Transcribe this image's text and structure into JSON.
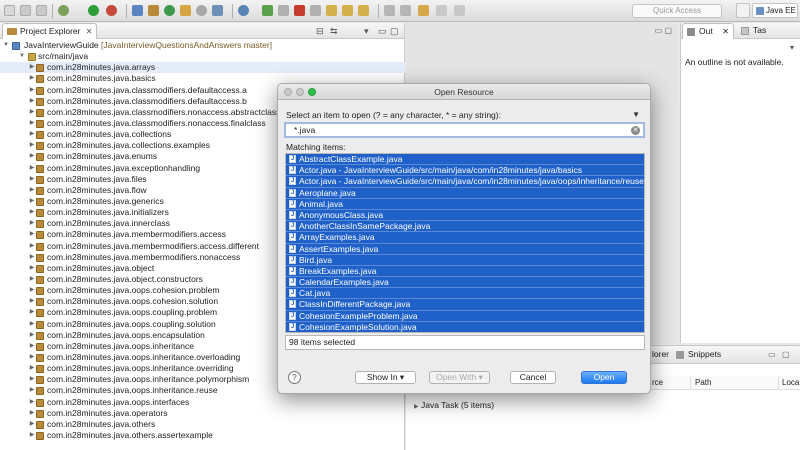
{
  "toolbar": {
    "quick_access_placeholder": "Quick Access",
    "perspective_label": "Java EE"
  },
  "project_explorer": {
    "tab_label": "Project Explorer",
    "tab_close": "✕",
    "project_name": "JavaInterviewGuide",
    "project_suffix": "[JavaInterviewQuestionsAndAnswers master]",
    "source_folder": "src/main/java",
    "packages": [
      "com.in28minutes.java.arrays",
      "com.in28minutes.java.basics",
      "com.in28minutes.java.classmodifiers.defaultaccess.a",
      "com.in28minutes.java.classmodifiers.defaultaccess.b",
      "com.in28minutes.java.classmodifiers.nonaccess.abstractclass",
      "com.in28minutes.java.classmodifiers.nonaccess.finalclass",
      "com.in28minutes.java.collections",
      "com.in28minutes.java.collections.examples",
      "com.in28minutes.java.enums",
      "com.in28minutes.java.exceptionhandling",
      "com.in28minutes.java.files",
      "com.in28minutes.java.flow",
      "com.in28minutes.java.generics",
      "com.in28minutes.java.initializers",
      "com.in28minutes.java.innerclass",
      "com.in28minutes.java.membermodifiers.access",
      "com.in28minutes.java.membermodifiers.access.different",
      "com.in28minutes.java.membermodifiers.nonaccess",
      "com.in28minutes.java.object",
      "com.in28minutes.java.object.constructors",
      "com.in28minutes.java.oops.cohesion.problem",
      "com.in28minutes.java.oops.cohesion.solution",
      "com.in28minutes.java.oops.coupling.problem",
      "com.in28minutes.java.oops.coupling.solution",
      "com.in28minutes.java.oops.encapsulation",
      "com.in28minutes.java.oops.inheritance",
      "com.in28minutes.java.oops.inheritance.overloading",
      "com.in28minutes.java.oops.inheritance.overriding",
      "com.in28minutes.java.oops.inheritance.polymorphism",
      "com.in28minutes.java.oops.inheritance.reuse",
      "com.in28minutes.java.oops.interfaces",
      "com.in28minutes.java.operators",
      "com.in28minutes.java.others",
      "com.in28minutes.java.others.assertexample"
    ]
  },
  "outline": {
    "tab_outline": "Out",
    "tab_tasks": "Tas",
    "empty_message": "An outline is not available."
  },
  "bottom_panel": {
    "tab_explorer_fragment": "lorer",
    "tab_snippets": "Snippets",
    "col_source_fragment": "rce",
    "col_path": "Path",
    "col_location_fragment": "Loca",
    "task_group": "Java Task (5 items)"
  },
  "dialog": {
    "title": "Open Resource",
    "prompt": "Select an item to open (? = any character, * = any string):",
    "filter_value": "*.java",
    "matching_label": "Matching items:",
    "items": [
      "AbstractClassExample.java",
      "Actor.java - JavaInterviewGuide/src/main/java/com/in28minutes/java/basics",
      "Actor.java - JavaInterviewGuide/src/main/java/com/in28minutes/java/oops/inheritance/reuse",
      "Aeroplane.java",
      "Animal.java",
      "AnonymousClass.java",
      "AnotherClassInSamePackage.java",
      "ArrayExamples.java",
      "AssertExamples.java",
      "Bird.java",
      "BreakExamples.java",
      "CalendarExamples.java",
      "Cat.java",
      "ClassInDifferentPackage.java",
      "CohesionExampleProblem.java",
      "CohesionExampleSolution.java"
    ],
    "status": "98 items selected",
    "help_label": "?",
    "show_in_label": "Show In ▾",
    "open_with_label": "Open With ▾",
    "cancel_label": "Cancel",
    "open_label": "Open"
  }
}
